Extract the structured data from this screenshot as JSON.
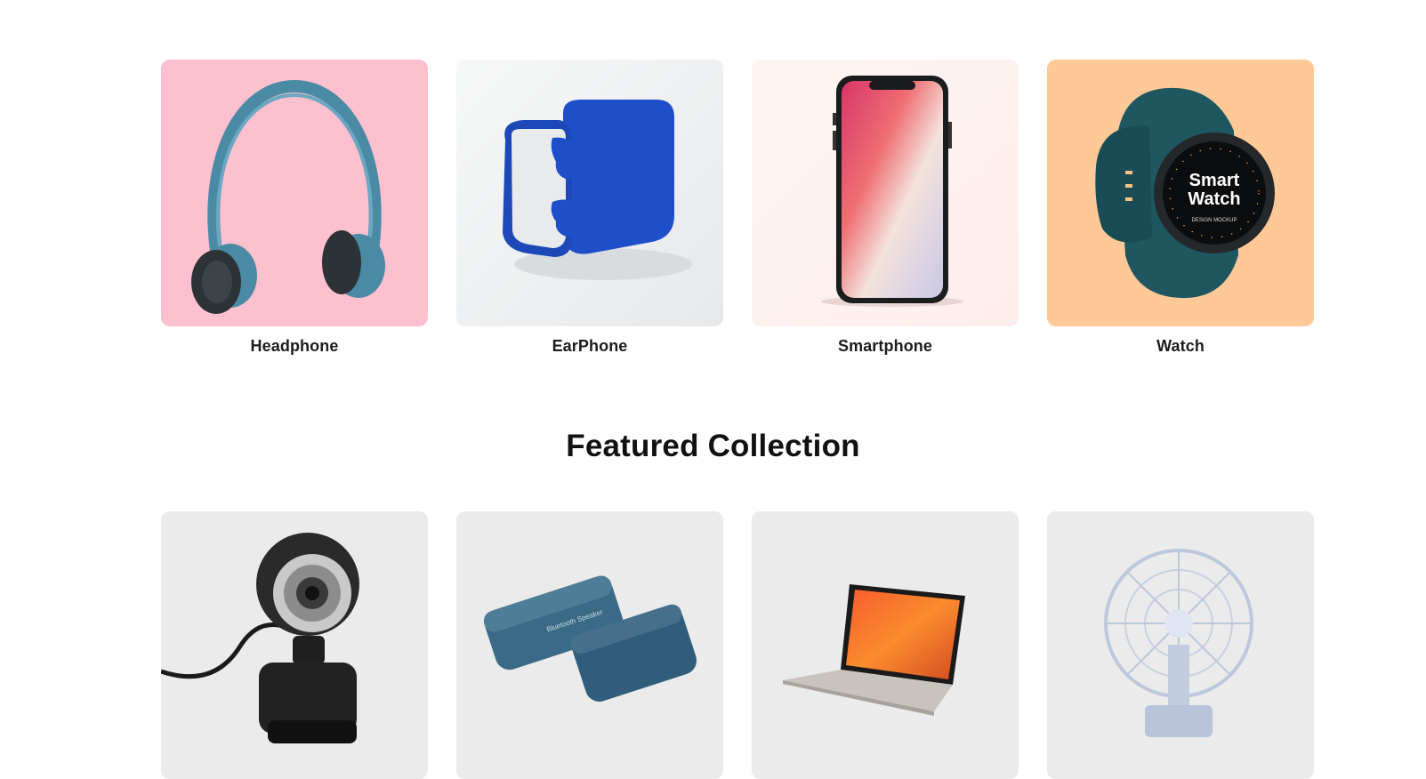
{
  "categories": [
    {
      "label": "Headphone",
      "icon": "headphone-image",
      "bg": "#fdc0cf"
    },
    {
      "label": "EarPhone",
      "icon": "earphone-image",
      "bg": "#f3f4f4"
    },
    {
      "label": "Smartphone",
      "icon": "smartphone-image",
      "bg": "#fdf0ee"
    },
    {
      "label": "Watch",
      "icon": "smartwatch-image",
      "bg": "#ffc997"
    }
  ],
  "watch_face": {
    "line1": "Smart",
    "line2": "Watch",
    "caption": "DESIGN MOCKUP"
  },
  "speaker_text": "Bluetooth Speaker",
  "featured": {
    "title": "Featured Collection",
    "items": [
      {
        "icon": "webcam-image",
        "bg": "#ebebeb"
      },
      {
        "icon": "bluetooth-speaker-image",
        "bg": "#ebebeb"
      },
      {
        "icon": "laptop-image",
        "bg": "#ebebeb"
      },
      {
        "icon": "desk-fan-image",
        "bg": "#ebebeb"
      }
    ]
  }
}
